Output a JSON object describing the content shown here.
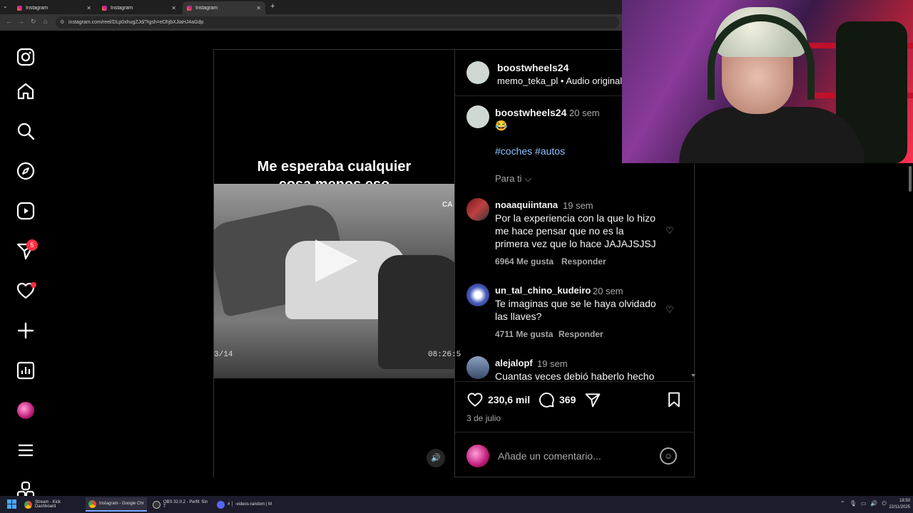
{
  "browser": {
    "tabs": [
      {
        "title": "Instagram"
      },
      {
        "title": "Instagram"
      },
      {
        "title": "Instagram"
      }
    ],
    "url": "instagram.com/reel/DLp0xhugZJd/?igsh=eDhjbXJiaHJ4aGdp"
  },
  "sidebar": {
    "messages_badge": "5"
  },
  "post": {
    "author": "boostwheels24",
    "audio_user": "memo_teka_pl",
    "audio_label": "Audio original",
    "video_overlay_line1": "Me esperaba cualquier",
    "video_overlay_line2": "cosa menos eso",
    "video_stamp_left": "3/14",
    "video_stamp_right": "08:26:5",
    "video_sign": "CA",
    "caption_user": "boostwheels24",
    "caption_time": "20 sem",
    "caption_emoji": "😂",
    "hashtags": "#coches #autos",
    "para_ti": "Para ti",
    "comments": [
      {
        "user": "noaaquiintana",
        "time": "19 sem",
        "text": "Por la experiencia con la que lo hizo me hace pensar que no es la primera vez que lo hace JAJAJSJSJ",
        "likes": "6964 Me gusta",
        "reply": "Responder"
      },
      {
        "user": "un_tal_chino_kudeiro",
        "time": "20 sem",
        "text": "Te imaginas que se le haya olvidado las llaves?",
        "likes": "4711 Me gusta",
        "reply": "Responder"
      },
      {
        "user": "alejalopf",
        "time": "19 sem",
        "text": "Cuantas veces debió haberlo hecho"
      }
    ],
    "likes_count": "230,6 mil",
    "comments_count": "369",
    "date": "3 de julio",
    "comment_placeholder": "Añade un comentario..."
  },
  "taskbar": {
    "items": [
      {
        "label": "Stream - Kick Dashboard"
      },
      {
        "label": "Instagram - Google Chr"
      },
      {
        "label": "OBS 32.0.2 - Perfil: Sin T"
      },
      {
        "label": "# │ -videos-random | M"
      }
    ],
    "time": "18:50",
    "date": "22/11/2025"
  },
  "colors": {
    "accent_link": "#8ec3ff",
    "badge": "#ff3040"
  }
}
